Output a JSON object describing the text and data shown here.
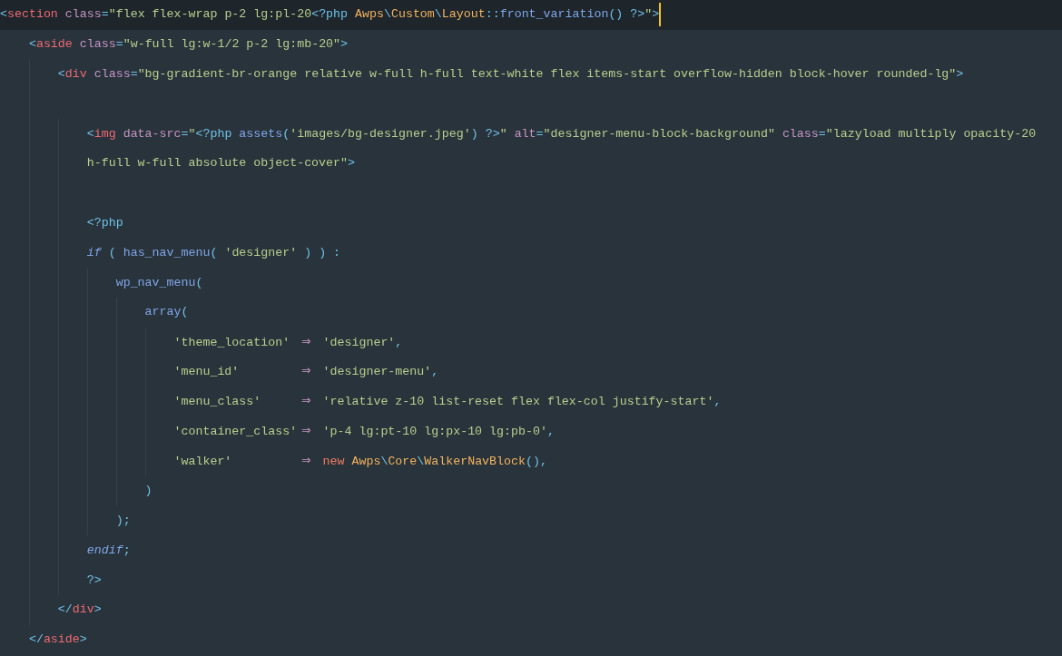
{
  "editor": {
    "lines": [
      {
        "current": true,
        "tokens": [
          {
            "t": "<",
            "kind": "punct"
          },
          {
            "t": "section ",
            "kind": "tag"
          },
          {
            "t": "class",
            "kind": "attr"
          },
          {
            "t": "=",
            "kind": "punct"
          },
          {
            "t": "\"flex flex-wrap p-2 lg:pl-20",
            "kind": "str"
          },
          {
            "t": "<?php ",
            "kind": "punct"
          },
          {
            "t": "Awps",
            "kind": "cls"
          },
          {
            "t": "\\",
            "kind": "punct"
          },
          {
            "t": "Custom",
            "kind": "cls"
          },
          {
            "t": "\\",
            "kind": "punct"
          },
          {
            "t": "Layout",
            "kind": "cls"
          },
          {
            "t": "::",
            "kind": "punct"
          },
          {
            "t": "front_variation",
            "kind": "fn"
          },
          {
            "t": "() ?>",
            "kind": "punct"
          },
          {
            "t": "\"",
            "kind": "str"
          },
          {
            "t": ">",
            "kind": "punct"
          }
        ]
      },
      {
        "current": false,
        "tokens": [
          {
            "t": "    <",
            "kind": "punct"
          },
          {
            "t": "aside ",
            "kind": "tag"
          },
          {
            "t": "class",
            "kind": "attr"
          },
          {
            "t": "=",
            "kind": "punct"
          },
          {
            "t": "\"w-full lg:w-1/2 p-2 lg:mb-20\"",
            "kind": "str"
          },
          {
            "t": ">",
            "kind": "punct"
          }
        ]
      },
      {
        "current": false,
        "tokens": [
          {
            "t": "        <",
            "kind": "punct"
          },
          {
            "t": "div ",
            "kind": "tag"
          },
          {
            "t": "class",
            "kind": "attr"
          },
          {
            "t": "=",
            "kind": "punct"
          },
          {
            "t": "\"bg-gradient-br-orange relative w-full h-full text-white flex items-start overflow-hidden block-hover rounded-lg\"",
            "kind": "str"
          },
          {
            "t": ">",
            "kind": "punct"
          }
        ]
      },
      {
        "current": false
      },
      {
        "current": false,
        "tokens": [
          {
            "t": "            <",
            "kind": "punct"
          },
          {
            "t": "img ",
            "kind": "tag"
          },
          {
            "t": "data-src",
            "kind": "attr"
          },
          {
            "t": "=",
            "kind": "punct"
          },
          {
            "t": "\"",
            "kind": "str"
          },
          {
            "t": "<?php ",
            "kind": "punct"
          },
          {
            "t": "assets",
            "kind": "fn"
          },
          {
            "t": "(",
            "kind": "punct"
          },
          {
            "t": "'images/bg-designer.jpeg'",
            "kind": "str"
          },
          {
            "t": ") ?>",
            "kind": "punct"
          },
          {
            "t": "\" ",
            "kind": "str"
          },
          {
            "t": "alt",
            "kind": "attr"
          },
          {
            "t": "=",
            "kind": "punct"
          },
          {
            "t": "\"designer-menu-block-background\" ",
            "kind": "str"
          },
          {
            "t": "class",
            "kind": "attr"
          },
          {
            "t": "=",
            "kind": "punct"
          },
          {
            "t": "\"lazyload multiply opacity-20",
            "kind": "str"
          }
        ]
      },
      {
        "current": false,
        "tokens": [
          {
            "t": "            h-full w-full absolute object-cover\"",
            "kind": "str"
          },
          {
            "t": ">",
            "kind": "punct"
          }
        ]
      },
      {
        "current": false
      },
      {
        "current": false,
        "tokens": [
          {
            "t": "            <?php",
            "kind": "punct"
          }
        ]
      },
      {
        "current": false,
        "tokens": [
          {
            "t": "            if",
            "kind": "kw"
          },
          {
            "t": " ( ",
            "kind": "punct"
          },
          {
            "t": "has_nav_menu",
            "kind": "fn"
          },
          {
            "t": "( ",
            "kind": "punct"
          },
          {
            "t": "'designer'",
            "kind": "str"
          },
          {
            "t": " ) ) :",
            "kind": "punct"
          }
        ]
      },
      {
        "current": false,
        "tokens": [
          {
            "t": "                wp_nav_menu",
            "kind": "fn"
          },
          {
            "t": "(",
            "kind": "punct"
          }
        ]
      },
      {
        "current": false,
        "tokens": [
          {
            "t": "                    array",
            "kind": "fn"
          },
          {
            "t": "(",
            "kind": "punct"
          }
        ]
      },
      {
        "current": false,
        "tokens": [
          {
            "t": "                        'theme_location' ",
            "kind": "str"
          },
          {
            "t": "⇒",
            "kind": "arrow"
          },
          {
            "t": " 'designer'",
            "kind": "str"
          },
          {
            "t": ",",
            "kind": "punct"
          }
        ]
      },
      {
        "current": false,
        "tokens": [
          {
            "t": "                        'menu_id'        ",
            "kind": "str"
          },
          {
            "t": "⇒",
            "kind": "arrow"
          },
          {
            "t": " 'designer-menu'",
            "kind": "str"
          },
          {
            "t": ",",
            "kind": "punct"
          }
        ]
      },
      {
        "current": false,
        "tokens": [
          {
            "t": "                        'menu_class'     ",
            "kind": "str"
          },
          {
            "t": "⇒",
            "kind": "arrow"
          },
          {
            "t": " 'relative z-10 list-reset flex flex-col justify-start'",
            "kind": "str"
          },
          {
            "t": ",",
            "kind": "punct"
          }
        ]
      },
      {
        "current": false,
        "tokens": [
          {
            "t": "                        'container_class'",
            "kind": "str"
          },
          {
            "t": "⇒",
            "kind": "arrow"
          },
          {
            "t": " 'p-4 lg:pt-10 lg:px-10 lg:pb-0'",
            "kind": "str"
          },
          {
            "t": ",",
            "kind": "punct"
          }
        ]
      },
      {
        "current": false,
        "tokens": [
          {
            "t": "                        'walker'         ",
            "kind": "str"
          },
          {
            "t": "⇒",
            "kind": "arrow"
          },
          {
            "t": " new ",
            "kind": "new"
          },
          {
            "t": "Awps",
            "kind": "cls"
          },
          {
            "t": "\\",
            "kind": "punct"
          },
          {
            "t": "Core",
            "kind": "cls"
          },
          {
            "t": "\\",
            "kind": "punct"
          },
          {
            "t": "WalkerNavBlock",
            "kind": "cls"
          },
          {
            "t": "(),",
            "kind": "punct"
          }
        ]
      },
      {
        "current": false,
        "tokens": [
          {
            "t": "                    )",
            "kind": "punct"
          }
        ]
      },
      {
        "current": false,
        "tokens": [
          {
            "t": "                );",
            "kind": "punct"
          }
        ]
      },
      {
        "current": false,
        "tokens": [
          {
            "t": "            endif",
            "kind": "kw"
          },
          {
            "t": ";",
            "kind": "punct"
          }
        ]
      },
      {
        "current": false,
        "tokens": [
          {
            "t": "            ?>",
            "kind": "punct"
          }
        ]
      },
      {
        "current": false,
        "tokens": [
          {
            "t": "        </",
            "kind": "punct"
          },
          {
            "t": "div",
            "kind": "tag"
          },
          {
            "t": ">",
            "kind": "punct"
          }
        ]
      },
      {
        "current": false,
        "tokens": [
          {
            "t": "    </",
            "kind": "punct"
          },
          {
            "t": "aside",
            "kind": "tag"
          },
          {
            "t": ">",
            "kind": "punct"
          }
        ]
      }
    ]
  }
}
